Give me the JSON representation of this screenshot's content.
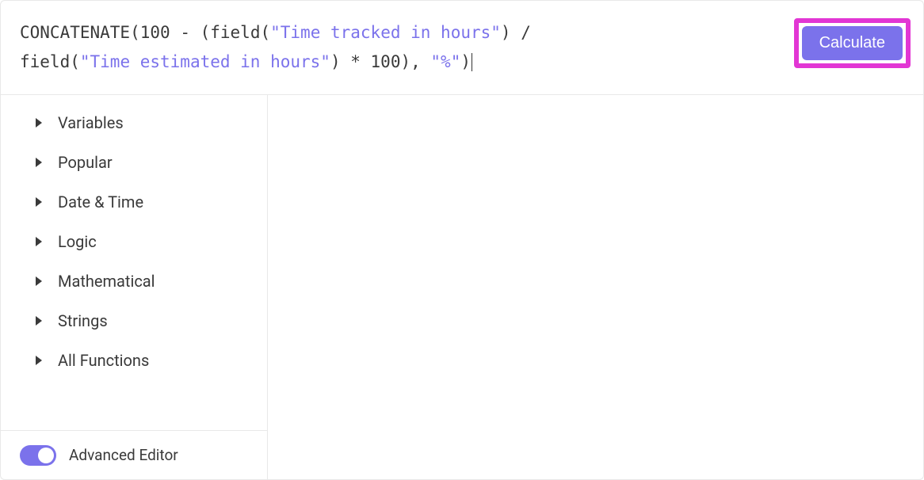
{
  "formula": {
    "tokens": [
      {
        "t": "CONCATENATE",
        "c": "tok-func"
      },
      {
        "t": "(",
        "c": "tok-op"
      },
      {
        "t": "100",
        "c": "tok-num"
      },
      {
        "t": " - (",
        "c": "tok-op"
      },
      {
        "t": "field",
        "c": "tok-func"
      },
      {
        "t": "(",
        "c": "tok-op"
      },
      {
        "t": "\"Time tracked in hours\"",
        "c": "tok-string"
      },
      {
        "t": ") / ",
        "c": "tok-op"
      },
      {
        "t": "\n",
        "c": ""
      },
      {
        "t": "field",
        "c": "tok-func"
      },
      {
        "t": "(",
        "c": "tok-op"
      },
      {
        "t": "\"Time estimated in hours\"",
        "c": "tok-string"
      },
      {
        "t": ") * ",
        "c": "tok-op"
      },
      {
        "t": "100",
        "c": "tok-num"
      },
      {
        "t": "), ",
        "c": "tok-op"
      },
      {
        "t": "\"%\"",
        "c": "tok-string"
      },
      {
        "t": ")",
        "c": "tok-op"
      }
    ]
  },
  "calculate_button": "Calculate",
  "sidebar": {
    "categories": [
      {
        "label": "Variables"
      },
      {
        "label": "Popular"
      },
      {
        "label": "Date & Time"
      },
      {
        "label": "Logic"
      },
      {
        "label": "Mathematical"
      },
      {
        "label": "Strings"
      },
      {
        "label": "All Functions"
      }
    ],
    "advanced_editor_label": "Advanced Editor",
    "advanced_editor_on": true
  },
  "colors": {
    "accent": "#7b72eb",
    "highlight_border": "#e236d4"
  }
}
